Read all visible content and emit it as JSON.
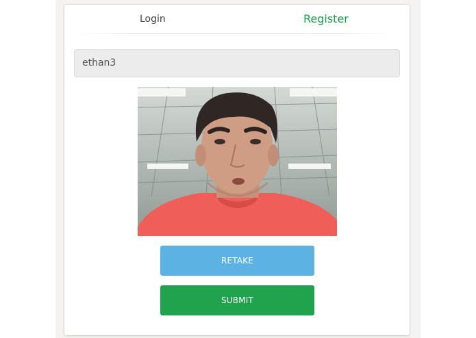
{
  "tabs": {
    "login": "Login",
    "register": "Register",
    "active": "Register"
  },
  "form": {
    "username_value": "ethan3"
  },
  "webcam": {
    "content": "user-photo"
  },
  "buttons": {
    "retake": "RETAKE",
    "submit": "SUBMIT"
  },
  "colors": {
    "active_tab": "#1a9f4f",
    "retake": "#5cb2e2",
    "submit": "#1fa34c"
  }
}
